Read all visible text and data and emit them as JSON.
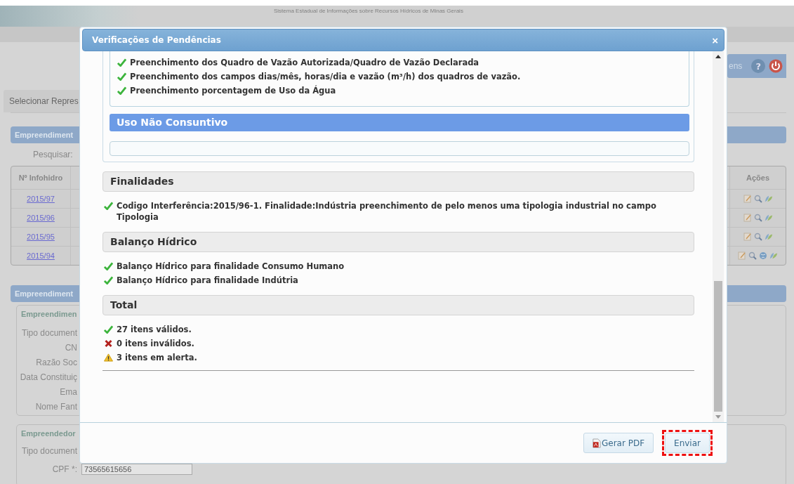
{
  "header": {
    "system_title": "Sistema Estadual de Informações sobre Recursos Hídricos de Minas Gerais",
    "user_menu_text": "ens",
    "help_label": "?"
  },
  "tab_label": "Selecionar Repres",
  "search_section": {
    "title": "Empreendiment",
    "search_label": "Pesquisar:"
  },
  "table": {
    "columns": [
      "Nº Infohidro",
      "Ações"
    ],
    "rows": [
      {
        "number": "2015/97",
        "extra_action": false
      },
      {
        "number": "2015/96",
        "extra_action": false
      },
      {
        "number": "2015/95",
        "extra_action": false
      },
      {
        "number": "2015/94",
        "extra_action": true
      }
    ]
  },
  "detail_section": {
    "title": "Empreendiment",
    "fieldset_title": "Empreendimen",
    "labels": [
      "Tipo document",
      "CN",
      "Razão Soc",
      "Data Constituiç",
      "Ema",
      "Nome Fant"
    ]
  },
  "owner_section": {
    "fieldset_title": "Empreendedor",
    "labels": [
      "Tipo document",
      "CPF *:"
    ],
    "cpf_value": "73565615656"
  },
  "dialog": {
    "title": "Verificações de Pendências",
    "close": "×",
    "nested_items": [
      {
        "kind": "valid",
        "text": "Preenchimento dos Quadro de Vazão Autorizada/Quadro de Vazão Declarada"
      },
      {
        "kind": "valid",
        "text": "Preenchimento dos campos dias/mês, horas/dia e vazão (m³/h) dos quadros de vazão."
      },
      {
        "kind": "valid",
        "text": "Preenchimento porcentagem de Uso da Água"
      }
    ],
    "subheader": "Uso Não Consuntivo",
    "groups": [
      {
        "title": "Finalidades",
        "items": [
          {
            "kind": "valid",
            "text": "Codigo Interferência:2015/96-1. Finalidade:Indústria preenchimento de pelo menos uma tipologia industrial no campo Tipologia"
          }
        ]
      },
      {
        "title": "Balanço Hídrico",
        "items": [
          {
            "kind": "valid",
            "text": "Balanço Hídrico para finalidade Consumo Humano"
          },
          {
            "kind": "valid",
            "text": "Balanço Hídrico para finalidade Indútria"
          }
        ]
      },
      {
        "title": "Total",
        "items": [
          {
            "kind": "valid",
            "text": "27 itens válidos."
          },
          {
            "kind": "invalid",
            "text": "0 itens inválidos."
          },
          {
            "kind": "alert",
            "text": "3 itens em alerta."
          }
        ]
      }
    ],
    "buttons": [
      {
        "label": "Gerar PDF",
        "kind": "pdf",
        "highlighted": false
      },
      {
        "label": "Enviar",
        "kind": "plain",
        "highlighted": true
      }
    ]
  }
}
